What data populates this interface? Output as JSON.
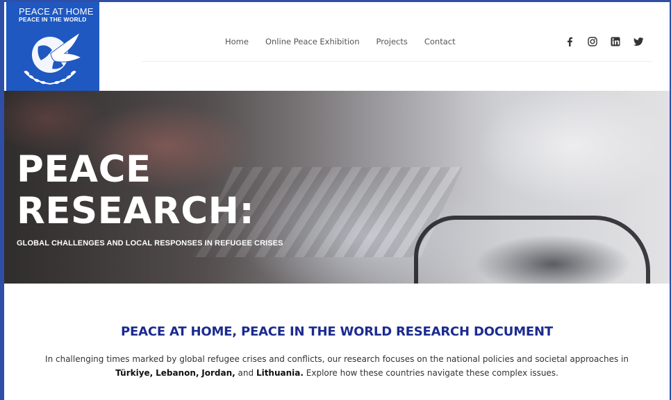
{
  "logo": {
    "line1": "PEACE AT HOME",
    "line2": "PEACE IN THE WORLD"
  },
  "nav": {
    "items": [
      {
        "label": "Home"
      },
      {
        "label": "Online Peace Exhibition"
      },
      {
        "label": "Projects"
      },
      {
        "label": "Contact"
      }
    ]
  },
  "social": {
    "icons": [
      "facebook-icon",
      "instagram-icon",
      "linkedin-icon",
      "twitter-icon"
    ]
  },
  "hero": {
    "title_line1": "PEACE",
    "title_line2": "RESEARCH:",
    "subtitle": "GLOBAL CHALLENGES AND LOCAL RESPONSES IN REFUGEE CRISES"
  },
  "section": {
    "title": "PEACE AT HOME, PEACE IN THE WORLD RESEARCH DOCUMENT",
    "text_part1": "In challenging times marked by global refugee crises and conflicts, our research focuses on the national policies and societal approaches in ",
    "country1": "Türkiye,",
    "country2": "Lebanon,",
    "country3": "Jordan,",
    "and_word": "and",
    "country4": "Lithuania.",
    "text_part2": "Explore how these countries navigate these complex issues."
  },
  "colors": {
    "frame_blue": "#2f4fa6",
    "logo_blue": "#1f58c0",
    "title_navy": "#1b2b8f"
  }
}
